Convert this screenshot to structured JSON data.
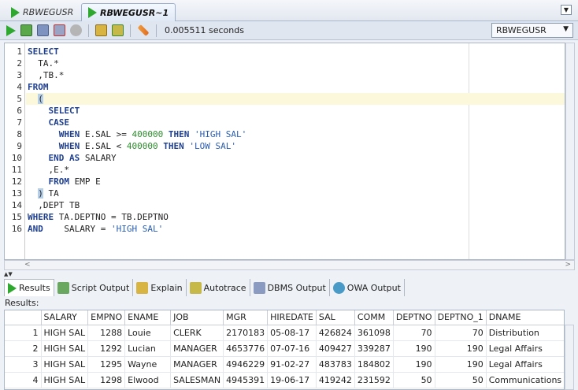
{
  "tabs": [
    {
      "label": "RBWEGUSR",
      "active": false
    },
    {
      "label": "RBWEGUSR~1",
      "active": true
    }
  ],
  "toolbar": {
    "elapsed": "0.005511 seconds",
    "connection": "RBWEGUSR"
  },
  "editor": {
    "line_numbers": [
      "1",
      "2",
      "3",
      "4",
      "5",
      "6",
      "7",
      "8",
      "9",
      "10",
      "11",
      "12",
      "13",
      "14",
      "15",
      "16"
    ],
    "lines": [
      [
        {
          "t": "SELECT",
          "c": "kw"
        }
      ],
      [
        {
          "t": "  TA.*",
          "c": ""
        }
      ],
      [
        {
          "t": "  ,TB.*",
          "c": ""
        }
      ],
      [
        {
          "t": "FROM",
          "c": "kw"
        }
      ],
      [
        {
          "t": "  ",
          "c": ""
        },
        {
          "t": "(",
          "c": "br"
        }
      ],
      [
        {
          "t": "    ",
          "c": ""
        },
        {
          "t": "SELECT",
          "c": "kw"
        }
      ],
      [
        {
          "t": "    ",
          "c": ""
        },
        {
          "t": "CASE",
          "c": "kw"
        }
      ],
      [
        {
          "t": "      ",
          "c": ""
        },
        {
          "t": "WHEN",
          "c": "kw"
        },
        {
          "t": " E.SAL >= ",
          "c": ""
        },
        {
          "t": "400000",
          "c": "num"
        },
        {
          "t": " ",
          "c": ""
        },
        {
          "t": "THEN",
          "c": "kw"
        },
        {
          "t": " ",
          "c": ""
        },
        {
          "t": "'HIGH SAL'",
          "c": "str"
        }
      ],
      [
        {
          "t": "      ",
          "c": ""
        },
        {
          "t": "WHEN",
          "c": "kw"
        },
        {
          "t": " E.SAL < ",
          "c": ""
        },
        {
          "t": "400000",
          "c": "num"
        },
        {
          "t": " ",
          "c": ""
        },
        {
          "t": "THEN",
          "c": "kw"
        },
        {
          "t": " ",
          "c": ""
        },
        {
          "t": "'LOW SAL'",
          "c": "str"
        }
      ],
      [
        {
          "t": "    ",
          "c": ""
        },
        {
          "t": "END",
          "c": "kw"
        },
        {
          "t": " ",
          "c": ""
        },
        {
          "t": "AS",
          "c": "kw"
        },
        {
          "t": " SALARY",
          "c": ""
        }
      ],
      [
        {
          "t": "    ,E.*",
          "c": ""
        }
      ],
      [
        {
          "t": "    ",
          "c": ""
        },
        {
          "t": "FROM",
          "c": "kw"
        },
        {
          "t": " EMP E",
          "c": ""
        }
      ],
      [
        {
          "t": "  ",
          "c": ""
        },
        {
          "t": ")",
          "c": "br"
        },
        {
          "t": " TA",
          "c": ""
        }
      ],
      [
        {
          "t": "  ,DEPT TB",
          "c": ""
        }
      ],
      [
        {
          "t": "WHERE",
          "c": "kw"
        },
        {
          "t": " TA.DEPTNO = TB.DEPTNO",
          "c": ""
        }
      ],
      [
        {
          "t": "AND",
          "c": "kw"
        },
        {
          "t": "    SALARY = ",
          "c": ""
        },
        {
          "t": "'HIGH SAL'",
          "c": "str"
        }
      ]
    ]
  },
  "result_tabs": [
    {
      "label": "Results",
      "icon": "play-icon"
    },
    {
      "label": "Script Output",
      "icon": "script-icon"
    },
    {
      "label": "Explain",
      "icon": "explain-icon"
    },
    {
      "label": "Autotrace",
      "icon": "autotrace-icon"
    },
    {
      "label": "DBMS Output",
      "icon": "dbms-icon"
    },
    {
      "label": "OWA Output",
      "icon": "owa-icon"
    }
  ],
  "results_label": "Results:",
  "grid": {
    "columns": [
      "",
      "SALARY",
      "EMPNO",
      "ENAME",
      "JOB",
      "MGR",
      "HIREDATE",
      "SAL",
      "COMM",
      "DEPTNO",
      "DEPTNO_1",
      "DNAME"
    ],
    "rows": [
      [
        "1",
        "HIGH SAL",
        "1288",
        "Louie",
        "CLERK",
        "2170183",
        "05-08-17",
        "426824",
        "361098",
        "70",
        "70",
        "Distribution"
      ],
      [
        "2",
        "HIGH SAL",
        "1292",
        "Lucian",
        "MANAGER",
        "4653776",
        "07-07-16",
        "409427",
        "339287",
        "190",
        "190",
        "Legal Affairs"
      ],
      [
        "3",
        "HIGH SAL",
        "1295",
        "Wayne",
        "MANAGER",
        "4946229",
        "91-02-27",
        "483783",
        "184802",
        "190",
        "190",
        "Legal Affairs"
      ],
      [
        "4",
        "HIGH SAL",
        "1298",
        "Elwood",
        "SALESMAN",
        "4945391",
        "19-06-17",
        "419242",
        "231592",
        "50",
        "50",
        "Communications"
      ]
    ]
  }
}
